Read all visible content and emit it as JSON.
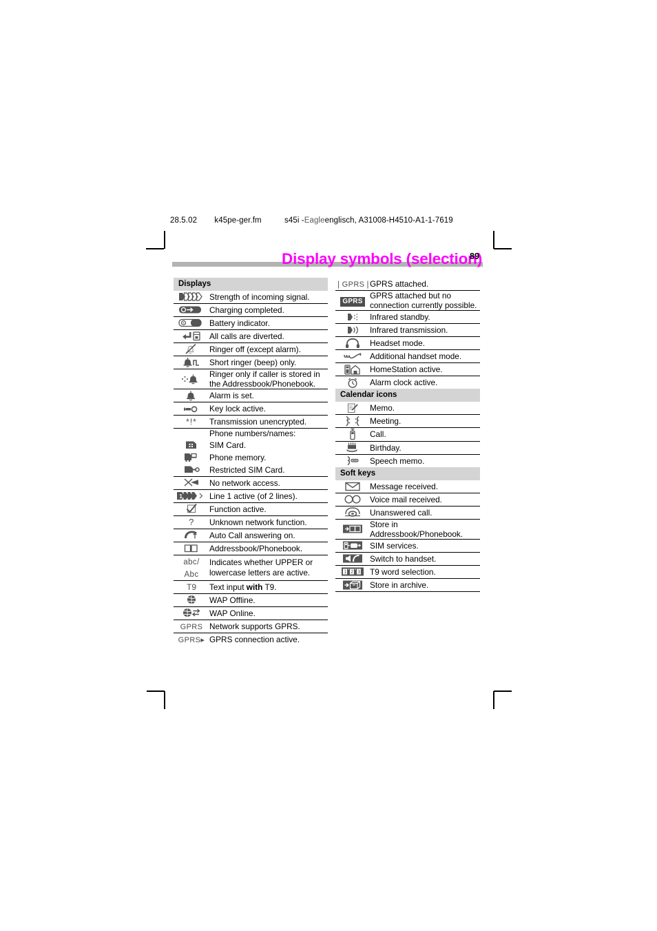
{
  "running_head": {
    "date": "28.5.02",
    "filename": "k45pe-ger.fm",
    "doc_id_prefix": "s45i - ",
    "doc_id_eagle": "Eagle",
    "doc_id_rest": " englisch, A31008-H4510-A1-1-7619"
  },
  "page": {
    "title": "Display symbols (selection)",
    "number": "89",
    "title_color": "#ff00ff",
    "bar_color": "#b3b3b3",
    "section_head_color": "#d4d4d4"
  },
  "left_column": {
    "section": "Displays",
    "rows": [
      {
        "icon": "signal-strength-icon",
        "text": "Strength of incoming signal."
      },
      {
        "icon": "battery-charged-icon",
        "text": "Charging completed."
      },
      {
        "icon": "battery-indicator-icon",
        "text": "Battery indicator."
      },
      {
        "icon": "call-diverted-icon",
        "text": "All calls are diverted."
      },
      {
        "icon": "ringer-off-icon",
        "text": "Ringer off (except alarm)."
      },
      {
        "icon": "short-ringer-icon",
        "text": "Short ringer (beep) only."
      },
      {
        "icon": "ringer-filtered-icon",
        "text": "Ringer only if caller is stored in the Addressbook/Phonebook."
      },
      {
        "icon": "alarm-bell-icon",
        "text": "Alarm is set."
      },
      {
        "icon": "key-lock-icon",
        "text": "Key lock active."
      },
      {
        "icon": "unencrypted-icon",
        "text": "Transmission unencrypted."
      },
      {
        "icon": "none",
        "text": "Phone numbers/names:"
      },
      {
        "icon": "sim-card-icon",
        "text": "SIM Card."
      },
      {
        "icon": "phone-memory-icon",
        "text": "Phone memory."
      },
      {
        "icon": "restricted-sim-icon",
        "text": "Restricted SIM Card."
      },
      {
        "icon": "no-network-icon",
        "text": "No network access."
      },
      {
        "icon": "line1-active-icon",
        "text": "Line 1 active (of 2 lines)."
      },
      {
        "icon": "function-active-icon",
        "text": "Function active."
      },
      {
        "icon": "unknown-network-icon",
        "text": "Unknown network function."
      },
      {
        "icon": "auto-answer-icon",
        "text": "Auto Call answering on."
      },
      {
        "icon": "addressbook-icon",
        "text": "Addressbook/Phonebook."
      },
      {
        "icon": "case-abc-icon",
        "text": "Indicates whether UPPER or lowercase letters are active.",
        "text_bold_segment": null
      },
      {
        "icon": "t9-icon",
        "text": "Text input with T9.",
        "bold_word": "with"
      },
      {
        "icon": "wap-offline-icon",
        "text": "WAP Offline."
      },
      {
        "icon": "wap-online-icon",
        "text": "WAP Online."
      },
      {
        "icon": "gprs-plain-icon",
        "text": "Network supports GPRS."
      },
      {
        "icon": "gprs-arrow-icon",
        "text": "GPRS connection active."
      }
    ]
  },
  "right_column": {
    "top_rows": [
      {
        "icon": "gprs-attached-icon",
        "text": "GPRS attached."
      },
      {
        "icon": "gprs-blocked-icon",
        "text": "GPRS attached but no connection currently possible."
      },
      {
        "icon": "infrared-standby-icon",
        "text": "Infrared standby."
      },
      {
        "icon": "infrared-transmit-icon",
        "text": "Infrared transmission."
      },
      {
        "icon": "headset-icon",
        "text": "Headset mode."
      },
      {
        "icon": "additional-handset-icon",
        "text": "Additional handset mode."
      },
      {
        "icon": "homestation-icon",
        "text": "HomeStation active."
      },
      {
        "icon": "alarm-clock-icon",
        "text": "Alarm clock active."
      }
    ],
    "calendar_section": "Calendar icons",
    "calendar_rows": [
      {
        "icon": "memo-icon",
        "text": "Memo."
      },
      {
        "icon": "meeting-icon",
        "text": "Meeting."
      },
      {
        "icon": "call-icon",
        "text": "Call."
      },
      {
        "icon": "birthday-icon",
        "text": "Birthday."
      },
      {
        "icon": "speech-memo-icon",
        "text": "Speech memo."
      }
    ],
    "softkeys_section": "Soft keys",
    "softkey_rows": [
      {
        "icon": "message-received-icon",
        "text": "Message received."
      },
      {
        "icon": "voice-mail-icon",
        "text": "Voice mail received."
      },
      {
        "icon": "unanswered-call-icon",
        "text": "Unanswered call."
      },
      {
        "icon": "store-addressbook-icon",
        "text": "Store in Addressbook/Phonebook."
      },
      {
        "icon": "sim-services-icon",
        "text": "SIM services."
      },
      {
        "icon": "switch-handset-icon",
        "text": "Switch to handset."
      },
      {
        "icon": "t9-word-selection-icon",
        "text": "T9 word selection."
      },
      {
        "icon": "store-archive-icon",
        "text": "Store in archive."
      }
    ]
  },
  "icon_text_labels": {
    "unencrypted": "*!*",
    "abc_line1": "abc/",
    "abc_line2": "Abc",
    "t9": "T9",
    "gprs": "GPRS",
    "gprs_arrow": "GPRS",
    "gprs_attached": "GPRS",
    "gprs_blocked": "GPRS",
    "question": "?"
  }
}
